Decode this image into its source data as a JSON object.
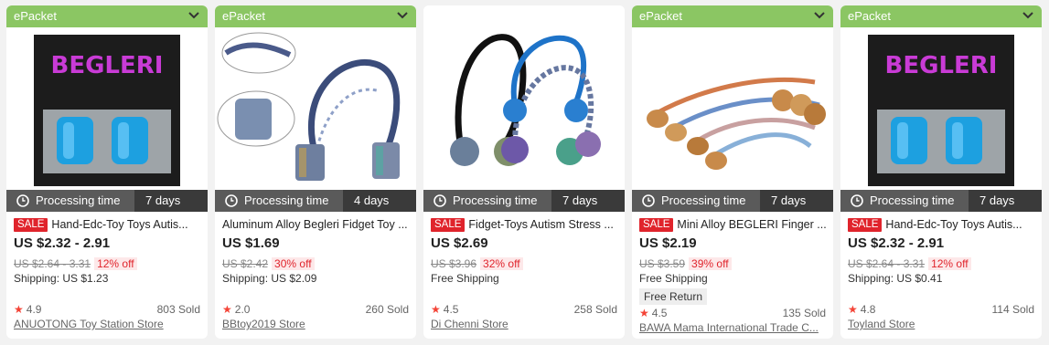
{
  "cards": [
    {
      "banner": "ePacket",
      "processing_label": "Processing time",
      "processing_days": "7 days",
      "sale": "SALE",
      "title": "Hand-Edc-Toy Toys Autis...",
      "price": "US $2.32 - 2.91",
      "orig_price": "US $2.64 - 3.31",
      "discount": "12% off",
      "shipping": "Shipping: US $1.23",
      "rating": "4.9",
      "sold": "803 Sold",
      "store": "ANUOTONG Toy Station Store"
    },
    {
      "banner": "ePacket",
      "processing_label": "Processing time",
      "processing_days": "4 days",
      "title": "Aluminum Alloy Begleri Fidget Toy ...",
      "price": "US $1.69",
      "orig_price": "US $2.42",
      "discount": "30% off",
      "shipping": "Shipping: US $2.09",
      "rating": "2.0",
      "sold": "260 Sold",
      "store": "BBtoy2019 Store"
    },
    {
      "processing_label": "Processing time",
      "processing_days": "7 days",
      "sale": "SALE",
      "title": "Fidget-Toys Autism Stress ...",
      "price": "US $2.69",
      "orig_price": "US $3.96",
      "discount": "32% off",
      "shipping": "Free Shipping",
      "rating": "4.5",
      "sold": "258 Sold",
      "store": "Di Chenni Store"
    },
    {
      "banner": "ePacket",
      "processing_label": "Processing time",
      "processing_days": "7 days",
      "sale": "SALE",
      "title": "Mini Alloy BEGLERI Finger ...",
      "price": "US $2.19",
      "orig_price": "US $3.59",
      "discount": "39% off",
      "shipping": "Free Shipping",
      "free_return": "Free Return",
      "rating": "4.5",
      "sold": "135 Sold",
      "store": "BAWA Mama International Trade C..."
    },
    {
      "banner": "ePacket",
      "processing_label": "Processing time",
      "processing_days": "7 days",
      "sale": "SALE",
      "title": "Hand-Edc-Toy Toys Autis...",
      "price": "US $2.32 - 2.91",
      "orig_price": "US $2.64 - 3.31",
      "discount": "12% off",
      "shipping": "Shipping: US $0.41",
      "rating": "4.8",
      "sold": "114 Sold",
      "store": "Toyland Store"
    }
  ],
  "logo_text": "BEGLERI",
  "colors": {
    "banner": "#8bc663",
    "sale": "#e0242c",
    "processing_bg": "#555555"
  }
}
